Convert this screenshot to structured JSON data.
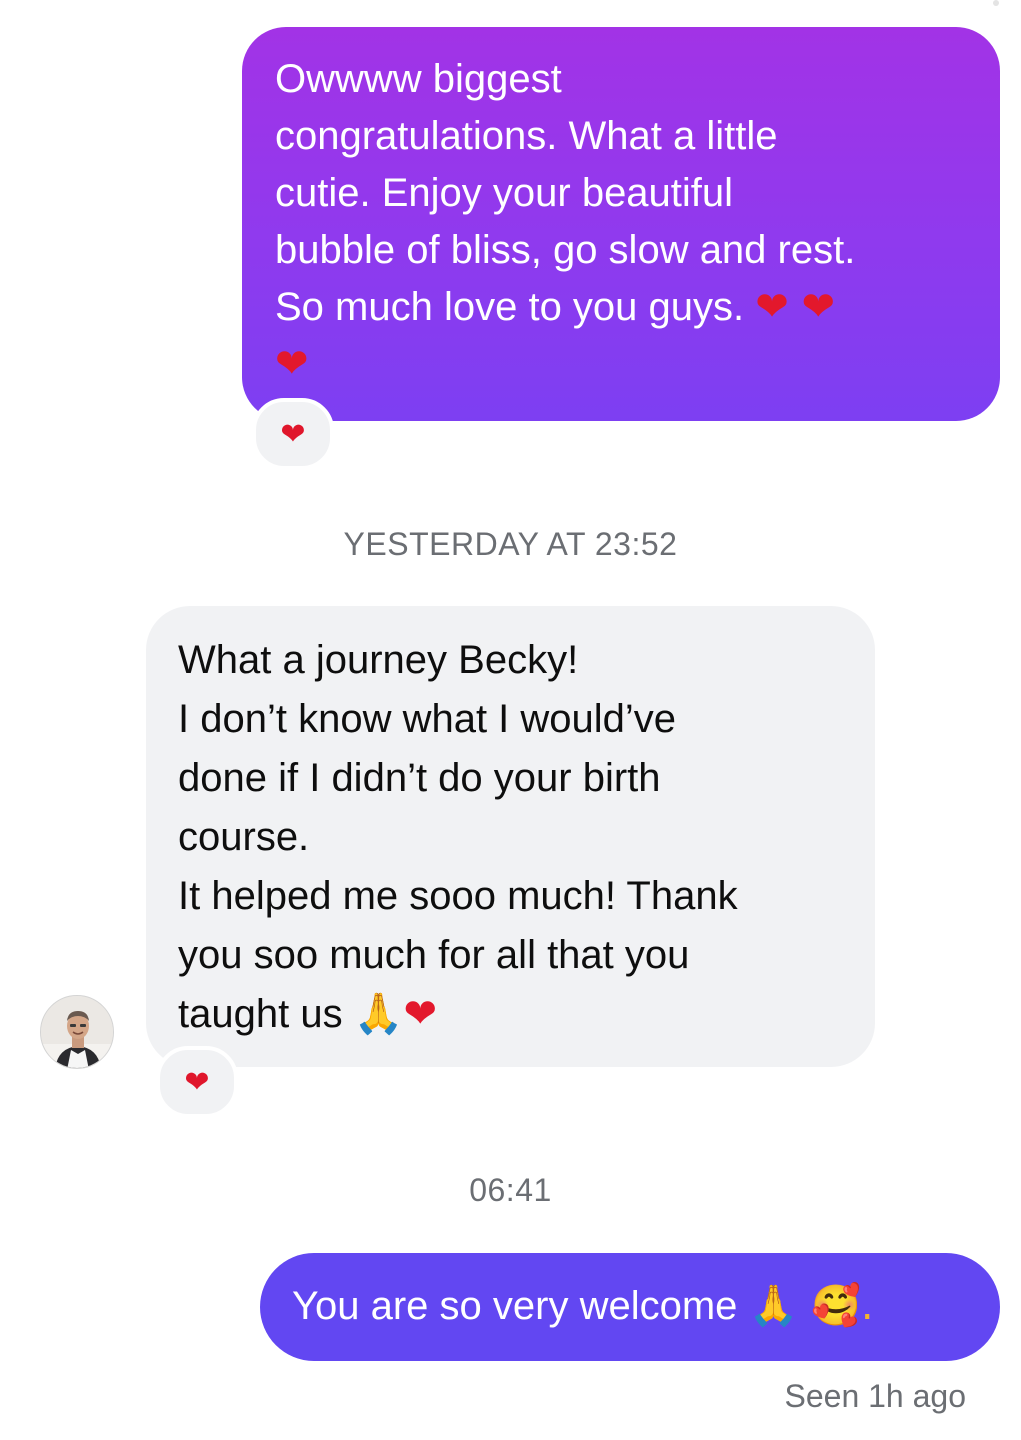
{
  "messages": [
    {
      "direction": "outgoing",
      "text": "Owwww biggest\ncongratulations. What a little\ncutie. Enjoy your beautiful\nbubble of bliss, go slow and rest.\nSo much love to you guys.",
      "emoji_trail": "❤ ❤\n❤",
      "reaction": "❤"
    },
    {
      "direction": "incoming",
      "text": "What a journey Becky!\nI don’t know what I would’ve\ndone if I didn’t do your birth\ncourse.\nIt helped me sooo much! Thank\nyou soo much for all that you\ntaught us",
      "emoji_trail": "🙏❤",
      "reaction": "❤"
    },
    {
      "direction": "outgoing",
      "text": "You are so very welcome",
      "emoji_trail": "🙏 🥰."
    }
  ],
  "timestamps": {
    "first": "YESTERDAY AT 23:52",
    "second": "06:41"
  },
  "seen_status": "Seen 1h ago",
  "colors": {
    "outgoing_gradient_top": "#a233e6",
    "outgoing_gradient_bottom": "#7d3ff2",
    "outgoing_solid": "#6247f2",
    "incoming_bg": "#f1f2f4",
    "heart": "#e3182c"
  },
  "icons": {
    "reaction": "heart-icon",
    "avatar": "contact-avatar"
  }
}
